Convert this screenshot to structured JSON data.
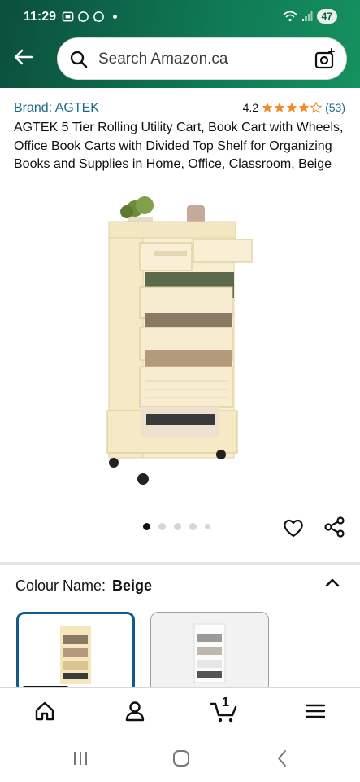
{
  "status_bar": {
    "time": "11:29",
    "battery": "47"
  },
  "search": {
    "placeholder": "Search Amazon.ca"
  },
  "product": {
    "brand": "Brand: AGTEK",
    "rating": "4.2",
    "rating_count": "(53)",
    "stars_filled": 4,
    "title": "AGTEK 5 Tier Rolling Utility Cart, Book Cart with Wheels, Office Book Carts with Divided Top Shelf for Organizing Books and Supplies in Home, Office, Classroom, Beige",
    "image_index": 1,
    "image_count": 5
  },
  "variation": {
    "label": "Colour Name:",
    "value": "Beige"
  },
  "bottom_nav": {
    "cart_count": "1"
  },
  "colors": {
    "header_start": "#0b4f3c",
    "header_end": "#15915f",
    "link": "#1f6a8a",
    "star": "#f08a24",
    "selected_border": "#135a8c"
  },
  "icons": [
    "back-arrow-icon",
    "search-icon",
    "camera-icon",
    "heart-icon",
    "share-icon",
    "chevron-up-icon",
    "home-icon",
    "account-icon",
    "cart-icon",
    "menu-icon"
  ]
}
